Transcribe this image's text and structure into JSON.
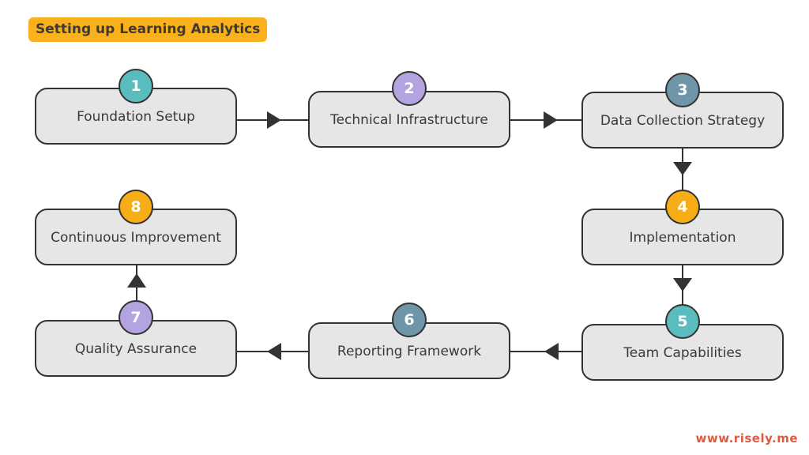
{
  "title": "Setting up Learning Analytics",
  "footer": "www.risely.me",
  "colors": {
    "title_bg": "#fbb11c",
    "footer_text": "#e05a41",
    "teal": "#5bbcc0",
    "purple": "#b3a3e0",
    "slate": "#6f95a8",
    "amber": "#f7ad17"
  },
  "steps": [
    {
      "number": "1",
      "label": "Foundation Setup",
      "badge_color": "#5bbcc0"
    },
    {
      "number": "2",
      "label": "Technical Infrastructure",
      "badge_color": "#b3a3e0"
    },
    {
      "number": "3",
      "label": "Data Collection Strategy",
      "badge_color": "#6f95a8"
    },
    {
      "number": "4",
      "label": "Implementation",
      "badge_color": "#f7ad17"
    },
    {
      "number": "5",
      "label": "Team Capabilities",
      "badge_color": "#5bbcc0"
    },
    {
      "number": "6",
      "label": "Reporting Framework",
      "badge_color": "#6f95a8"
    },
    {
      "number": "7",
      "label": "Quality Assurance",
      "badge_color": "#b3a3e0"
    },
    {
      "number": "8",
      "label": "Continuous Improvement",
      "badge_color": "#f7ad17"
    }
  ],
  "connections": [
    {
      "from": "1",
      "to": "2",
      "direction": "right"
    },
    {
      "from": "2",
      "to": "3",
      "direction": "right"
    },
    {
      "from": "3",
      "to": "4",
      "direction": "down"
    },
    {
      "from": "4",
      "to": "5",
      "direction": "down"
    },
    {
      "from": "5",
      "to": "6",
      "direction": "left"
    },
    {
      "from": "6",
      "to": "7",
      "direction": "left"
    },
    {
      "from": "7",
      "to": "8",
      "direction": "up"
    }
  ]
}
